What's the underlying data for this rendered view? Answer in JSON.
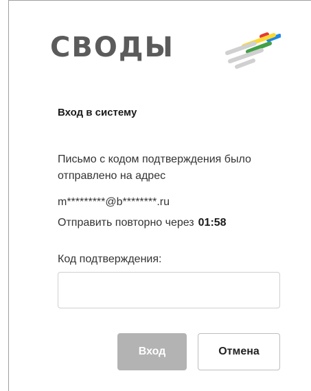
{
  "brand": {
    "name": "СВОДЫ",
    "stripe_colors": [
      "#e53935",
      "#1e88e5",
      "#fdd835",
      "#43a047",
      "#d0d0d0"
    ]
  },
  "form": {
    "heading": "Вход в систему",
    "message": "Письмо с кодом подтверждения было отправлено на адрес",
    "email": "m*********@b********.ru",
    "resend_label": "Отправить повторно через",
    "resend_timer": "01:58",
    "code_label": "Код подтверждения:",
    "code_value": "",
    "code_placeholder": ""
  },
  "buttons": {
    "login": "Вход",
    "cancel": "Отмена"
  }
}
